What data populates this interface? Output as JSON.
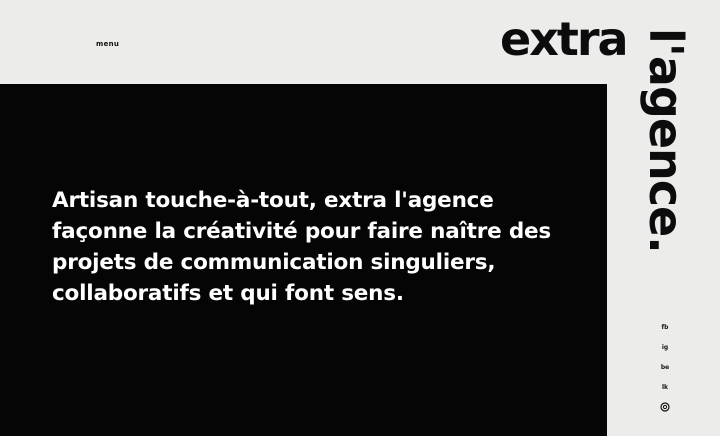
{
  "header": {
    "menu_label": "menu"
  },
  "logo": {
    "word1": "extra",
    "word2": "l'agence."
  },
  "hero": {
    "text": "Artisan touche-à-tout, extra l'agence façonne la créativité pour faire naître des projets de communication singuliers, collaboratifs et qui font sens."
  },
  "social": {
    "links": [
      "fb",
      "ig",
      "be",
      "lk"
    ],
    "last_icon": "instagram-circle-icon"
  },
  "colors": {
    "background": "#ececea",
    "hero_background": "#050505",
    "hero_text": "#ffffff",
    "ink": "#0c0c0c"
  }
}
